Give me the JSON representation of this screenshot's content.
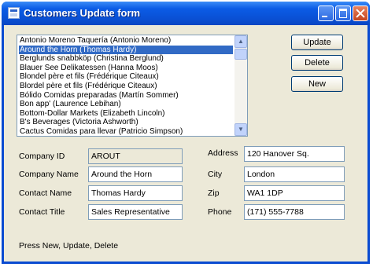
{
  "window": {
    "title": "Customers Update form"
  },
  "list": {
    "selected_index": 1,
    "items": [
      "Antonio Moreno Taquería (Antonio Moreno)",
      "Around the Horn (Thomas Hardy)",
      "Berglunds snabbköp (Christina Berglund)",
      "Blauer See Delikatessen (Hanna Moos)",
      "Blondel père et fils (Frédérique Citeaux)",
      "Blordel père et fils (Frédérique Citeaux)",
      "Bólido Comidas preparadas (Martín Sommer)",
      "Bon app' (Laurence Lebihan)",
      "Bottom-Dollar Markets (Elizabeth Lincoln)",
      "B's Beverages (Victoria Ashworth)",
      "Cactus Comidas para llevar (Patricio Simpson)"
    ]
  },
  "buttons": {
    "update": "Update",
    "delete": "Delete",
    "new": "New"
  },
  "fields": {
    "company_id": {
      "label": "Company ID",
      "value": "AROUT"
    },
    "company_name": {
      "label": "Company Name",
      "value": "Around the Horn"
    },
    "contact_name": {
      "label": "Contact Name",
      "value": "Thomas Hardy"
    },
    "contact_title": {
      "label": "Contact Title",
      "value": "Sales Representative"
    },
    "address": {
      "label": "Address",
      "value": "120 Hanover Sq."
    },
    "city": {
      "label": "City",
      "value": "London"
    },
    "zip": {
      "label": "Zip",
      "value": "WA1 1DP"
    },
    "phone": {
      "label": "Phone",
      "value": "(171) 555-7788"
    }
  },
  "status": "Press New, Update, Delete",
  "colors": {
    "title_bar": "#0a4fd3",
    "selection": "#316ac5",
    "dialog_bg": "#ece9d8",
    "input_border": "#7f9db9"
  }
}
